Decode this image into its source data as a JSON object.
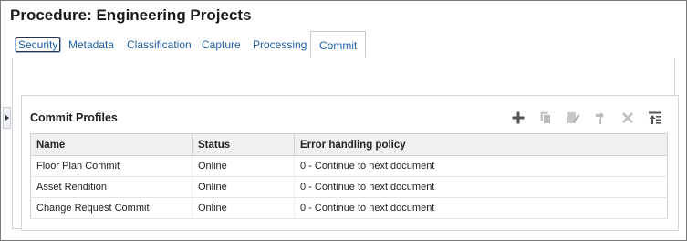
{
  "page": {
    "title": "Procedure: Engineering Projects"
  },
  "tabs": [
    {
      "label": "Security"
    },
    {
      "label": "Metadata"
    },
    {
      "label": "Classification"
    },
    {
      "label": "Capture"
    },
    {
      "label": "Processing"
    },
    {
      "label": "Commit"
    }
  ],
  "active_tab": "Commit",
  "panel": {
    "title": "Commit Profiles",
    "toolbar": [
      "add-icon",
      "copy-icon",
      "edit-icon",
      "move-icon",
      "delete-icon",
      "move-to-top-icon"
    ],
    "columns": [
      "Name",
      "Status",
      "Error handling policy"
    ],
    "rows": [
      [
        "Floor Plan Commit",
        "Online",
        "0 - Continue to next document"
      ],
      [
        "Asset Rendition",
        "Online",
        "0 - Continue to next document"
      ],
      [
        "Change Request Commit",
        "Online",
        "0 - Continue to next document"
      ]
    ]
  },
  "colors": {
    "link": "#1f5ea8",
    "header_bg": "#eef0f2",
    "border": "#d6d6d6"
  }
}
